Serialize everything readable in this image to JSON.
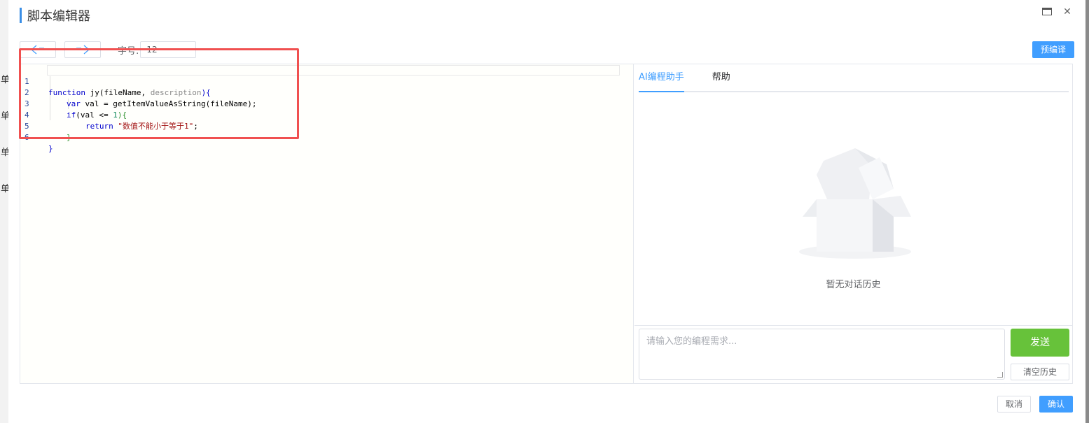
{
  "background": {
    "chars": [
      "单",
      "单",
      "单",
      "单"
    ]
  },
  "dialog": {
    "title": "脚本编辑器",
    "window_buttons": {
      "maximize_icon": "maximize-icon",
      "close_glyph": "✕"
    }
  },
  "toolbar": {
    "undo_icon": "undo-arrow-icon",
    "redo_icon": "redo-arrow-icon",
    "font_size_label": "字号:",
    "font_size_value": "12",
    "precompile_label": "预编译"
  },
  "editor": {
    "lines": [
      {
        "no": "1"
      },
      {
        "no": "2"
      },
      {
        "no": "3"
      },
      {
        "no": "4"
      },
      {
        "no": "5"
      },
      {
        "no": "6"
      }
    ],
    "code": {
      "l1_kw": "function",
      "l1_name": " jy(fileName, ",
      "l1_param": "description",
      "l1_end": "){",
      "l2_kw": "var",
      "l2_rest": " val = getItemValueAsString(fileName);",
      "l3_kw": "if",
      "l3_mid": "(val <= ",
      "l3_num": "1",
      "l3_end": "){",
      "l4_kw": "return",
      "l4_str": " \"数值不能小于等于1\"",
      "l4_end": ";",
      "l5": "}",
      "l6": "}"
    }
  },
  "ai_panel": {
    "tabs": [
      {
        "label": "AI编程助手",
        "active": true
      },
      {
        "label": "帮助",
        "active": false
      }
    ],
    "empty_text": "暂无对话历史",
    "input_placeholder": "请输入您的编程需求...",
    "send_label": "发送",
    "clear_label": "清空历史"
  },
  "footer": {
    "cancel_label": "取消",
    "ok_label": "确认"
  },
  "colors": {
    "accent": "#409eff",
    "send": "#67c23a",
    "highlight": "#f05050"
  }
}
